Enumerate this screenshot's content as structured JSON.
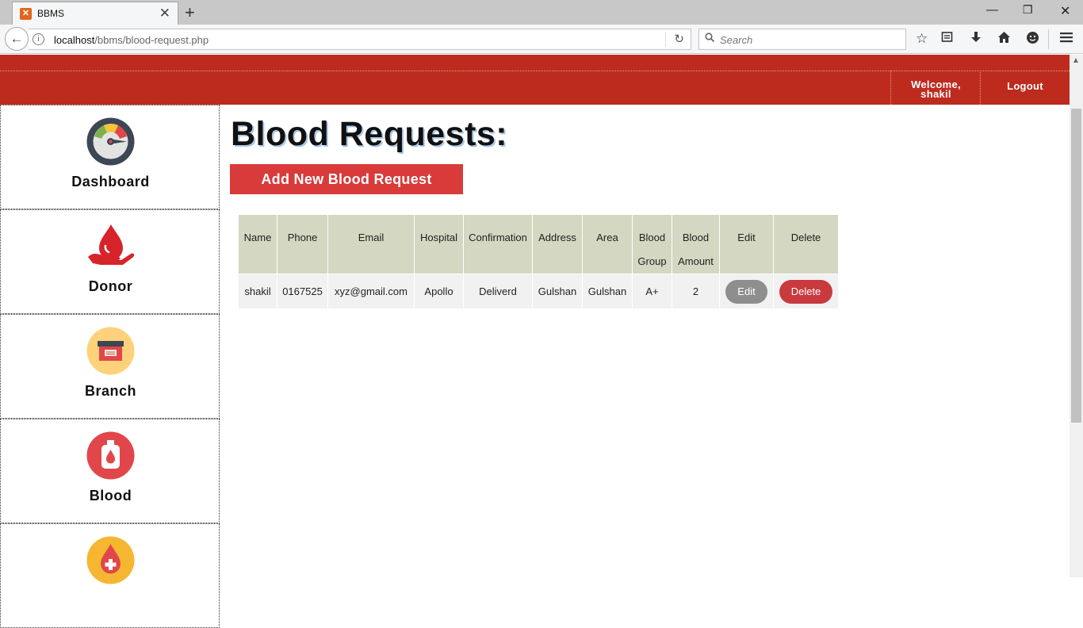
{
  "browser": {
    "tab_title": "BBMS",
    "tab_favicon_glyph": "✕",
    "url_host": "localhost",
    "url_path": "/bbms/blood-request.php",
    "search_placeholder": "Search",
    "icons": [
      "star-icon",
      "reading-list-icon",
      "download-icon",
      "home-icon",
      "smiley-icon",
      "menu-icon"
    ]
  },
  "header": {
    "welcome_line1": "Welcome,",
    "welcome_line2": "shakil",
    "logout_label": "Logout"
  },
  "sidebar": {
    "items": [
      {
        "label": "Dashboard",
        "icon": "gauge-icon"
      },
      {
        "label": "Donor",
        "icon": "blood-drop-hand-icon"
      },
      {
        "label": "Branch",
        "icon": "box-icon"
      },
      {
        "label": "Blood",
        "icon": "blood-bag-icon"
      },
      {
        "label": "",
        "icon": "blood-drop-plus-icon"
      }
    ]
  },
  "main": {
    "title": "Blood Requests:",
    "add_button": "Add New Blood Request",
    "table": {
      "headers": [
        "Name",
        "Phone",
        "Email",
        "Hospital",
        "Confirmation",
        "Address",
        "Area",
        "Blood Group",
        "Blood Amount",
        "Edit",
        "Delete"
      ],
      "rows": [
        {
          "name": "shakil",
          "phone": "0167525",
          "email": "xyz@gmail.com",
          "hospital": "Apollo",
          "confirmation": "Deliverd",
          "address": "Gulshan",
          "area": "Gulshan",
          "blood_group": "A+",
          "blood_amount": "2",
          "edit_label": "Edit",
          "delete_label": "Delete"
        }
      ]
    }
  },
  "colors": {
    "header_red": "#bd2b1f",
    "button_red": "#d93a3a",
    "table_header": "#d4d7c1",
    "edit_gray": "#8e8e8e",
    "delete_red": "#c93a3f"
  }
}
